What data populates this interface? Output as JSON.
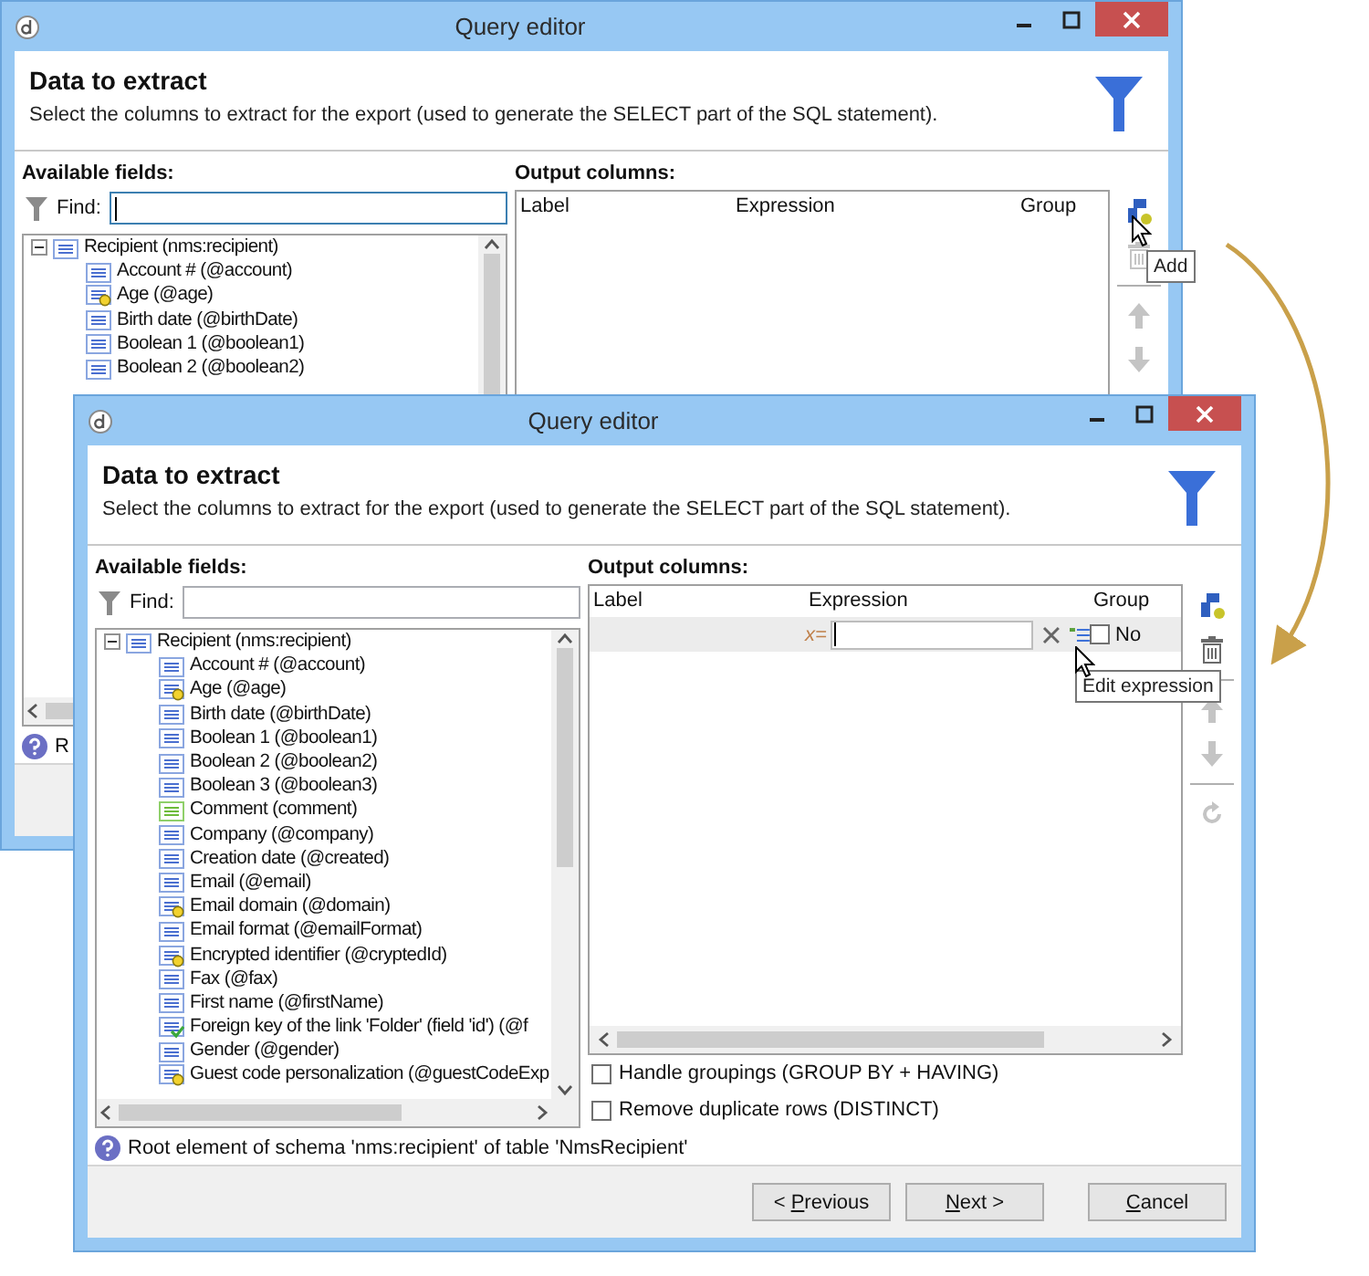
{
  "windows": [
    {
      "title": "Query editor",
      "header": {
        "title": "Data to extract",
        "description": "Select the columns to extract for the export (used to generate the SELECT part of the SQL statement)."
      },
      "available_fields": {
        "label": "Available fields:",
        "find_label": "Find:",
        "find_focused": true,
        "tree": [
          {
            "label": "Recipient (nms:recipient)",
            "kind": "schema",
            "expanded": true,
            "children": [
              {
                "label": "Account # (@account)",
                "kind": "field"
              },
              {
                "label": "Age (@age)",
                "kind": "calc"
              },
              {
                "label": "Birth date (@birthDate)",
                "kind": "field"
              },
              {
                "label": "Boolean 1 (@boolean1)",
                "kind": "field"
              },
              {
                "label": "Boolean 2 (@boolean2)",
                "kind": "field"
              }
            ]
          }
        ]
      },
      "output_columns": {
        "label": "Output columns:",
        "columns": [
          "Label",
          "Expression",
          "Group"
        ]
      },
      "tools": [
        {
          "kind": "add",
          "disabled": false
        },
        {
          "kind": "delete",
          "disabled": true
        },
        {
          "kind": "up",
          "disabled": true
        },
        {
          "kind": "down",
          "disabled": true
        }
      ],
      "tooltip": "Add",
      "status": "R"
    },
    {
      "title": "Query editor",
      "header": {
        "title": "Data to extract",
        "description": "Select the columns to extract for the export (used to generate the SELECT part of the SQL statement)."
      },
      "available_fields": {
        "label": "Available fields:",
        "find_label": "Find:",
        "find_focused": false,
        "tree": [
          {
            "label": "Recipient (nms:recipient)",
            "kind": "schema",
            "expanded": true,
            "children": [
              {
                "label": "Account # (@account)",
                "kind": "field"
              },
              {
                "label": "Age (@age)",
                "kind": "calc"
              },
              {
                "label": "Birth date (@birthDate)",
                "kind": "field"
              },
              {
                "label": "Boolean 1 (@boolean1)",
                "kind": "field"
              },
              {
                "label": "Boolean 2 (@boolean2)",
                "kind": "field"
              },
              {
                "label": "Boolean 3 (@boolean3)",
                "kind": "field"
              },
              {
                "label": "Comment (comment)",
                "kind": "xml"
              },
              {
                "label": "Company (@company)",
                "kind": "field"
              },
              {
                "label": "Creation date (@created)",
                "kind": "field"
              },
              {
                "label": "Email (@email)",
                "kind": "field"
              },
              {
                "label": "Email domain (@domain)",
                "kind": "calc"
              },
              {
                "label": "Email format (@emailFormat)",
                "kind": "field"
              },
              {
                "label": "Encrypted identifier (@cryptedId)",
                "kind": "calc"
              },
              {
                "label": "Fax (@fax)",
                "kind": "field"
              },
              {
                "label": "First name (@firstName)",
                "kind": "field"
              },
              {
                "label": "Foreign key of the link 'Folder' (field 'id') (@f",
                "kind": "link"
              },
              {
                "label": "Gender (@gender)",
                "kind": "field"
              },
              {
                "label": "Guest code personalization (@guestCodeExp",
                "kind": "calc"
              }
            ]
          }
        ]
      },
      "output_columns": {
        "label": "Output columns:",
        "columns": [
          "Label",
          "Expression",
          "Group"
        ],
        "rows": [
          {
            "prefix": "x=",
            "focused": true,
            "group": "No",
            "group_checked": false
          }
        ]
      },
      "tools": [
        {
          "kind": "add",
          "disabled": false
        },
        {
          "kind": "delete",
          "disabled": false
        },
        {
          "kind": "up",
          "disabled": true
        },
        {
          "kind": "down",
          "disabled": true
        },
        {
          "kind": "refresh",
          "disabled": true
        }
      ],
      "tooltip": "Edit expression",
      "options": [
        {
          "label": "Handle groupings (GROUP BY + HAVING)",
          "checked": false
        },
        {
          "label": "Remove duplicate rows (DISTINCT)",
          "checked": false
        }
      ],
      "status": "Root element of schema 'nms:recipient' of table 'NmsRecipient'",
      "buttons": [
        {
          "pre": "< ",
          "key": "P",
          "post": "revious"
        },
        {
          "key": "N",
          "post": "ext >"
        },
        {
          "key": "C",
          "post": "ancel"
        }
      ]
    }
  ]
}
